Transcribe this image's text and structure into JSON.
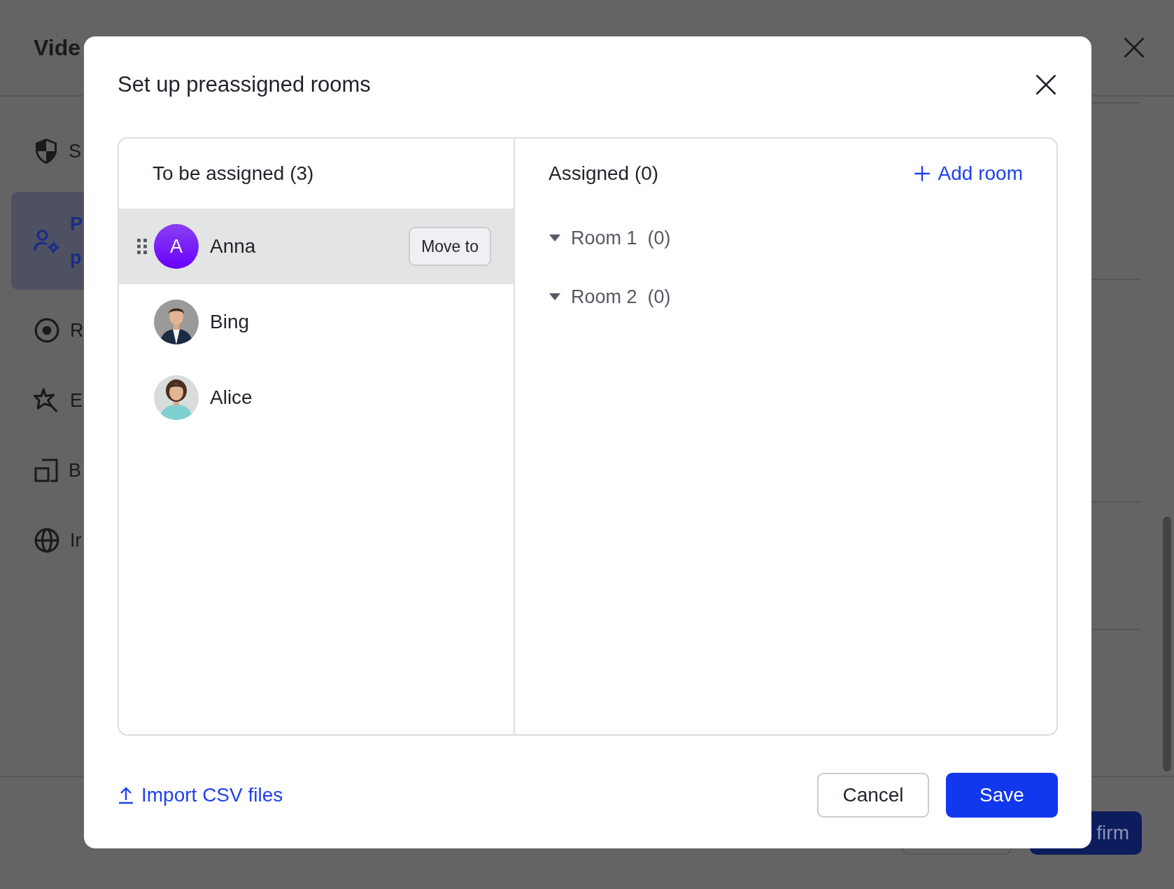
{
  "background": {
    "title": "Vide",
    "sidebar": [
      {
        "lines": [
          "S"
        ],
        "selected": false
      },
      {
        "lines": [
          "P",
          "p"
        ],
        "selected": true
      },
      {
        "lines": [
          "R"
        ],
        "selected": false
      },
      {
        "lines": [
          "E"
        ],
        "selected": false
      },
      {
        "lines": [
          "B"
        ],
        "selected": false
      },
      {
        "lines": [
          "Ir"
        ],
        "selected": false
      }
    ],
    "confirm_button": "firm"
  },
  "dialog": {
    "title": "Set up preassigned rooms",
    "unassigned": {
      "heading": "To be assigned (3)",
      "people": [
        {
          "name": "Anna",
          "avatar": {
            "kind": "initial",
            "letter": "A"
          },
          "selected": true,
          "action": "Move to"
        },
        {
          "name": "Bing",
          "selected": false
        },
        {
          "name": "Alice",
          "selected": false
        }
      ]
    },
    "assigned": {
      "heading": "Assigned (0)",
      "add_room": "Add room",
      "rooms": [
        {
          "name": "Room 1",
          "count": "(0)",
          "expanded": true
        },
        {
          "name": "Room 2",
          "count": "(0)",
          "expanded": true
        }
      ]
    },
    "import_link": "Import CSV files",
    "buttons": {
      "cancel": "Cancel",
      "save": "Save"
    }
  }
}
